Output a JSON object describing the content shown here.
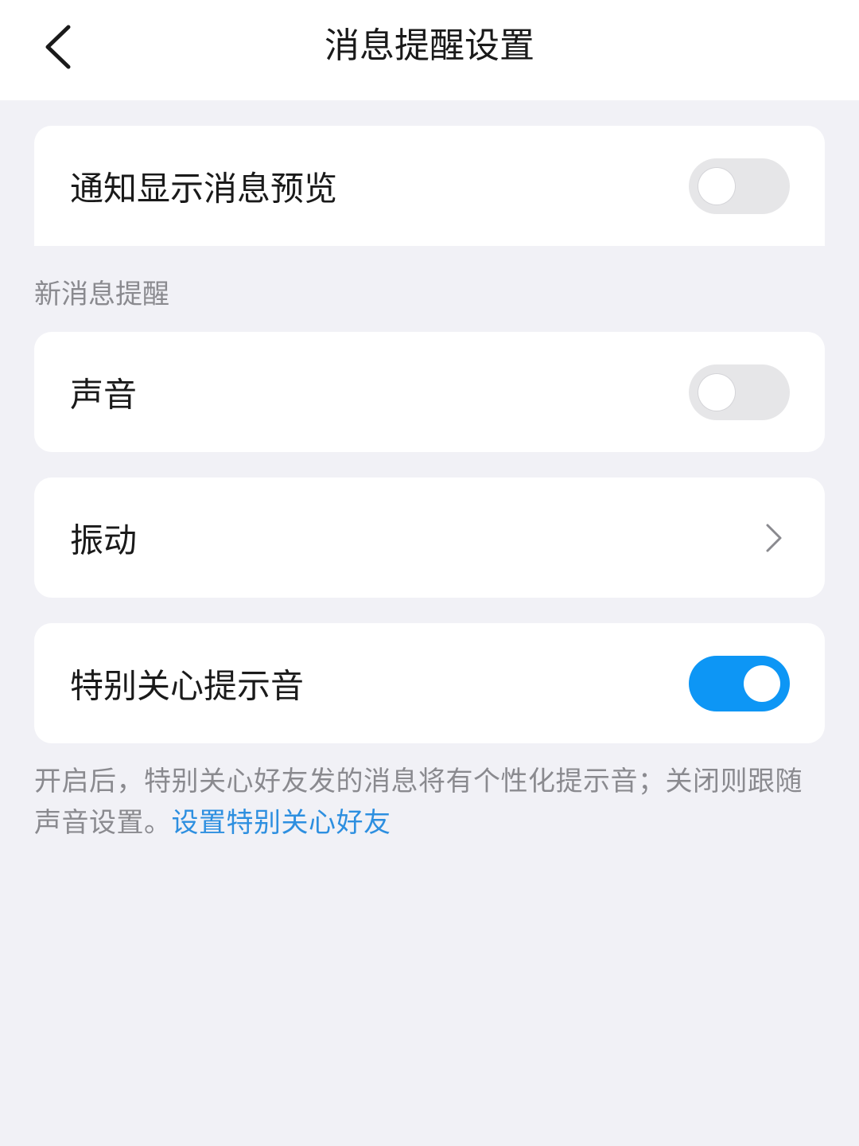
{
  "header": {
    "title": "消息提醒设置",
    "back_icon": "chevron-left-icon"
  },
  "preview_row": {
    "label": "通知显示消息预览",
    "enabled": false
  },
  "section_title": "新消息提醒",
  "sound_row": {
    "label": "声音",
    "enabled": false
  },
  "vibrate_row": {
    "label": "振动",
    "icon": "chevron-right-icon"
  },
  "special_row": {
    "label": "特别关心提示音",
    "enabled": true
  },
  "footnote": {
    "text": "开启后，特别关心好友发的消息将有个性化提示音；关闭则跟随声音设置。",
    "link_text": "设置特别关心好友"
  },
  "colors": {
    "background": "#f1f1f6",
    "toggle_on": "#0d96f5",
    "toggle_off": "#e6e6e8",
    "link": "#2d8fe0",
    "secondary_text": "#8a8a8f"
  }
}
